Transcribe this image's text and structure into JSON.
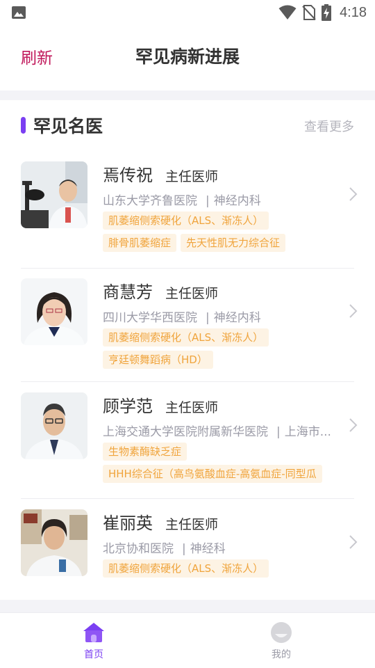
{
  "status_bar": {
    "time": "4:18"
  },
  "header": {
    "refresh_label": "刷新",
    "title": "罕见病新进展"
  },
  "section": {
    "title": "罕见名医",
    "see_more_label": "查看更多"
  },
  "doctors": [
    {
      "name": "焉传祝",
      "title": "主任医师",
      "hospital": "山东大学齐鲁医院",
      "department": "神经内科",
      "tags": [
        [
          "肌萎缩侧索硬化（ALS、渐冻人）"
        ],
        [
          "腓骨肌萎缩症",
          "先天性肌无力综合征"
        ]
      ]
    },
    {
      "name": "商慧芳",
      "title": "主任医师",
      "hospital": "四川大学华西医院",
      "department": "神经内科",
      "tags": [
        [
          "肌萎缩侧索硬化（ALS、渐冻人）"
        ],
        [
          "亨廷顿舞蹈病（HD）"
        ]
      ]
    },
    {
      "name": "顾学范",
      "title": "主任医师",
      "hospital": "上海交通大学医院附属新华医院",
      "department": "上海市...",
      "tags": [
        [
          "生物素酶缺乏症"
        ],
        [
          "HHH综合征（高鸟氨酸血症-高氨血症-同型瓜"
        ]
      ]
    },
    {
      "name": "崔丽英",
      "title": "主任医师",
      "hospital": "北京协和医院",
      "department": "神经科",
      "tags": [
        [
          "肌萎缩侧索硬化（ALS、渐冻人）"
        ]
      ]
    }
  ],
  "tabbar": {
    "home_label": "首页",
    "mine_label": "我的",
    "active_color": "#7b3ff2",
    "inactive_color": "#9a9aa6"
  },
  "colors": {
    "accent": "#7b3ff2",
    "refresh": "#c0175a",
    "tag_bg": "#fdf3e4",
    "tag_text": "#f0a43c"
  }
}
